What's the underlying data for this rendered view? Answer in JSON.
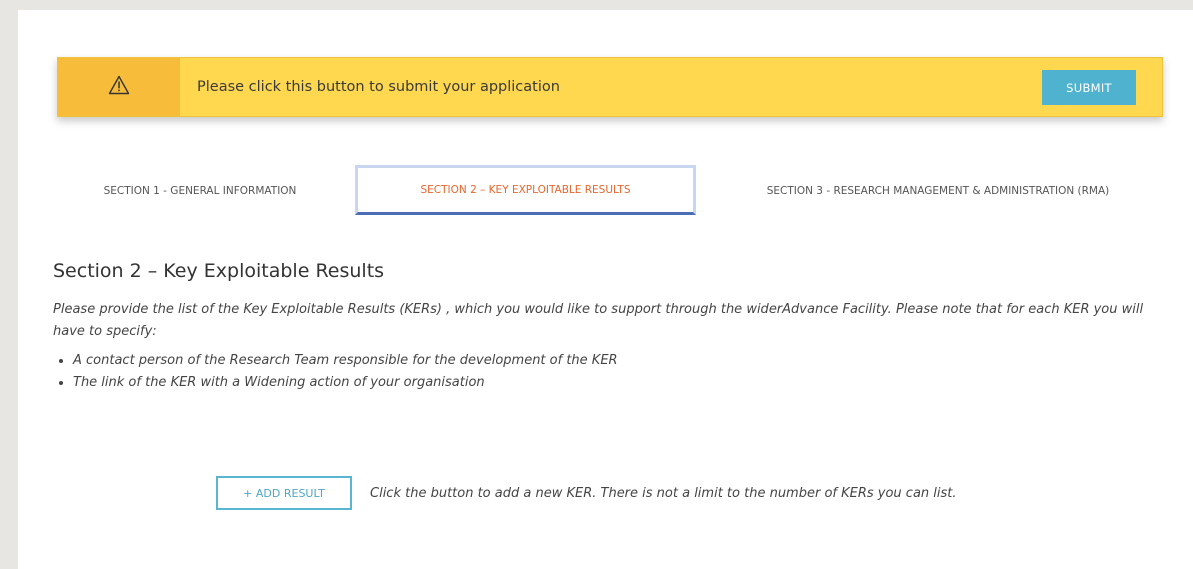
{
  "alert": {
    "icon": "warning-triangle-icon",
    "message": "Please click this button to submit your application",
    "submit_label": "SUBMIT",
    "colors": {
      "banner": "#ffd84f",
      "icon_box": "#f7bd3a",
      "button": "#4fb2cf"
    }
  },
  "tabs": [
    {
      "label": "SECTION 1 - GENERAL INFORMATION",
      "active": false
    },
    {
      "label": "SECTION 2 – KEY EXPLOITABLE RESULTS",
      "active": true
    },
    {
      "label": "SECTION 3 - RESEARCH MANAGEMENT & ADMINISTRATION (RMA)",
      "active": false
    }
  ],
  "active_tab_color": "#e8662c",
  "section": {
    "title": "Section 2 – Key Exploitable Results",
    "intro": "Please provide the list of the Key Exploitable Results (KERs) , which you would like to support through the widerAdvance Facility. Please note that for each KER you will have to specify:",
    "bullets": [
      "A contact person of the Research Team responsible for the development of the KER",
      "The link of the KER with a Widening action of your organisation"
    ]
  },
  "add_result": {
    "button_label": "+ ADD RESULT",
    "help_text": "Click the button to add a new KER. There is not a limit to the number of KERs you can list."
  }
}
